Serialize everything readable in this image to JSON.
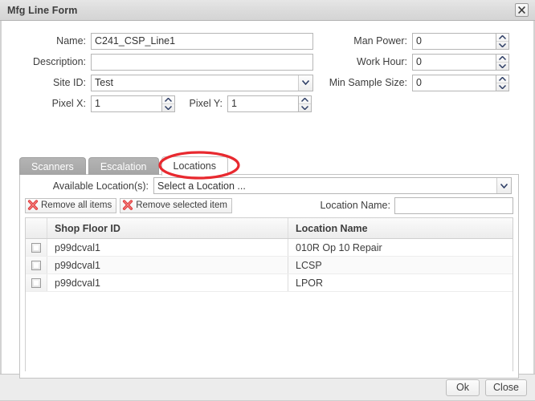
{
  "window": {
    "title": "Mfg Line Form",
    "close_icon": "close-x-icon"
  },
  "form": {
    "name": {
      "label": "Name:",
      "value": "C241_CSP_Line1"
    },
    "description": {
      "label": "Description:",
      "value": ""
    },
    "site_id": {
      "label": "Site ID:",
      "value": "Test",
      "icon": "chevron-down-icon"
    },
    "pixel_x": {
      "label": "Pixel X:",
      "value": "1"
    },
    "pixel_y": {
      "label": "Pixel Y:",
      "value": "1"
    },
    "man_power": {
      "label": "Man Power:",
      "value": "0"
    },
    "work_hour": {
      "label": "Work Hour:",
      "value": "0"
    },
    "min_sample_size": {
      "label": "Min Sample Size:",
      "value": "0"
    }
  },
  "tabs": [
    {
      "label": "Scanners",
      "active": false
    },
    {
      "label": "Escalation",
      "active": false
    },
    {
      "label": "Locations",
      "active": true
    }
  ],
  "locations_panel": {
    "available_locations": {
      "label": "Available Location(s):",
      "value": "Select a Location ...",
      "icon": "chevron-down-icon"
    },
    "remove_all_button": {
      "label": "Remove all items",
      "icon": "red-x-icon"
    },
    "remove_selected_button": {
      "label": "Remove selected item",
      "icon": "red-x-icon"
    },
    "location_name": {
      "label": "Location Name:",
      "value": ""
    },
    "grid": {
      "columns": [
        "",
        "Shop Floor ID",
        "Location Name"
      ],
      "rows": [
        {
          "checked": false,
          "shop_floor_id": "p99dcval1",
          "location_name": "010R Op 10 Repair"
        },
        {
          "checked": false,
          "shop_floor_id": "p99dcval1",
          "location_name": "LCSP"
        },
        {
          "checked": false,
          "shop_floor_id": "p99dcval1",
          "location_name": "LPOR"
        }
      ]
    }
  },
  "footer": {
    "ok_label": "Ok",
    "close_label": "Close"
  },
  "annotation": {
    "shape": "red-ellipse-highlight",
    "color": "#e8292f",
    "targets": "Locations tab"
  }
}
